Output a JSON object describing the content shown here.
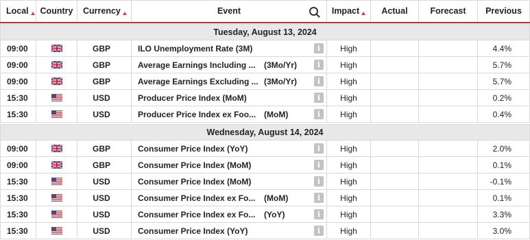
{
  "header": {
    "local": "Local",
    "country": "Country",
    "currency": "Currency",
    "event": "Event",
    "impact": "Impact",
    "actual": "Actual",
    "forecast": "Forecast",
    "previous": "Previous"
  },
  "colors": {
    "accent": "#cc2b2b",
    "day_bg": "#e8e8e8",
    "info_bg": "#c3c3c3"
  },
  "days": [
    {
      "label": "Tuesday, August 13, 2024",
      "events": [
        {
          "time": "09:00",
          "flag": "gb-flag-icon",
          "currency": "GBP",
          "name": "ILO Unemployment Rate (3M)",
          "period": "",
          "impact": "High",
          "actual": "",
          "forecast": "",
          "previous": "4.4%"
        },
        {
          "time": "09:00",
          "flag": "gb-flag-icon",
          "currency": "GBP",
          "name": "Average Earnings Including ...",
          "period": "(3Mo/Yr)",
          "impact": "High",
          "actual": "",
          "forecast": "",
          "previous": "5.7%"
        },
        {
          "time": "09:00",
          "flag": "gb-flag-icon",
          "currency": "GBP",
          "name": "Average Earnings Excluding ...",
          "period": "(3Mo/Yr)",
          "impact": "High",
          "actual": "",
          "forecast": "",
          "previous": "5.7%"
        },
        {
          "time": "15:30",
          "flag": "us-flag-icon",
          "currency": "USD",
          "name": "Producer Price Index (MoM)",
          "period": "",
          "impact": "High",
          "actual": "",
          "forecast": "",
          "previous": "0.2%"
        },
        {
          "time": "15:30",
          "flag": "us-flag-icon",
          "currency": "USD",
          "name": "Producer Price Index ex Foo...",
          "period": "(MoM)",
          "impact": "High",
          "actual": "",
          "forecast": "",
          "previous": "0.4%"
        }
      ]
    },
    {
      "label": "Wednesday, August 14, 2024",
      "events": [
        {
          "time": "09:00",
          "flag": "gb-flag-icon",
          "currency": "GBP",
          "name": "Consumer Price Index (YoY)",
          "period": "",
          "impact": "High",
          "actual": "",
          "forecast": "",
          "previous": "2.0%"
        },
        {
          "time": "09:00",
          "flag": "gb-flag-icon",
          "currency": "GBP",
          "name": "Consumer Price Index (MoM)",
          "period": "",
          "impact": "High",
          "actual": "",
          "forecast": "",
          "previous": "0.1%"
        },
        {
          "time": "15:30",
          "flag": "us-flag-icon",
          "currency": "USD",
          "name": "Consumer Price Index (MoM)",
          "period": "",
          "impact": "High",
          "actual": "",
          "forecast": "",
          "previous": "-0.1%"
        },
        {
          "time": "15:30",
          "flag": "us-flag-icon",
          "currency": "USD",
          "name": "Consumer Price Index ex Fo...",
          "period": "(MoM)",
          "impact": "High",
          "actual": "",
          "forecast": "",
          "previous": "0.1%"
        },
        {
          "time": "15:30",
          "flag": "us-flag-icon",
          "currency": "USD",
          "name": "Consumer Price Index ex Fo...",
          "period": "(YoY)",
          "impact": "High",
          "actual": "",
          "forecast": "",
          "previous": "3.3%"
        },
        {
          "time": "15:30",
          "flag": "us-flag-icon",
          "currency": "USD",
          "name": "Consumer Price Index (YoY)",
          "period": "",
          "impact": "High",
          "actual": "",
          "forecast": "",
          "previous": "3.0%"
        }
      ]
    }
  ]
}
